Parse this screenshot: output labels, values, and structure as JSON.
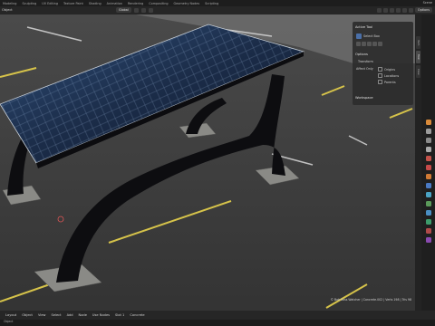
{
  "topbar": {
    "workspaces": [
      "Modeling",
      "Sculpting",
      "UV Editing",
      "Texture Paint",
      "Shading",
      "Animation",
      "Rendering",
      "Compositing",
      "Geometry Nodes",
      "Scripting"
    ],
    "scene_label": "Scene"
  },
  "header": {
    "editor_label": "Object",
    "orientation": "Global",
    "options_label": "Options"
  },
  "npanel": {
    "active_tool_title": "Active Tool",
    "tool_name": "Select Box",
    "options_title": "Options",
    "transform_label": "Transform",
    "affect_only_label": "Affect Only",
    "origins_label": "Origins",
    "locations_label": "Locations",
    "parents_label": "Parents",
    "workspace_title": "Workspace"
  },
  "vtabs": [
    "Item",
    "Tool",
    "View"
  ],
  "footer": {
    "frame": "Layout",
    "mode": "Object",
    "menus": [
      "View",
      "Select",
      "Add",
      "Node"
    ],
    "use_nodes": "Use Nodes",
    "slot": "Slot 1",
    "material": "Concrete"
  },
  "version_text": "© Bob Ross Watcher | Concrete.002 | Verts 198 | Tris 98",
  "status_text": "Object",
  "colors": {
    "panel_bg": "#2d2d2d",
    "accent": "#4a6fa8",
    "asphalt": "#3a3a3a",
    "parking_line": "#d8c64a"
  }
}
